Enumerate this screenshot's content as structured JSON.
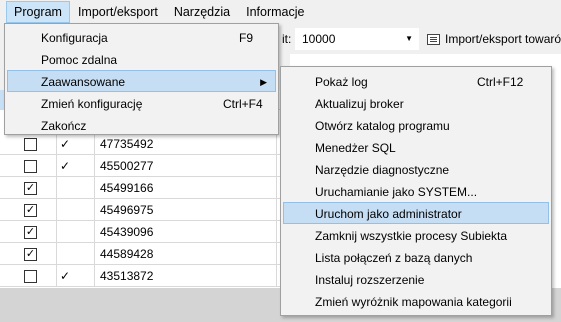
{
  "menubar": {
    "items": [
      {
        "label": "Program"
      },
      {
        "label": "Import/eksport"
      },
      {
        "label": "Narzędzia"
      },
      {
        "label": "Informacje"
      }
    ]
  },
  "toolbar": {
    "limit_label_tail": "it:",
    "limit_value": "10000",
    "import_button_label": "Import/eksport towarów"
  },
  "program_menu": {
    "items": [
      {
        "label": "Konfiguracja",
        "shortcut": "F9"
      },
      {
        "label": "Pomoc zdalna",
        "shortcut": ""
      },
      {
        "label": "Zaawansowane",
        "shortcut": "",
        "submenu": true
      },
      {
        "label": "Zmień konfigurację",
        "shortcut": "Ctrl+F4"
      },
      {
        "label": "Zakończ",
        "shortcut": ""
      }
    ]
  },
  "advanced_submenu": {
    "items": [
      {
        "label": "Pokaż log",
        "shortcut": "Ctrl+F12"
      },
      {
        "label": "Aktualizuj broker",
        "shortcut": ""
      },
      {
        "label": "Otwórz katalog programu",
        "shortcut": ""
      },
      {
        "label": "Menedżer SQL",
        "shortcut": ""
      },
      {
        "label": "Narzędzie diagnostyczne",
        "shortcut": ""
      },
      {
        "label": "Uruchamianie jako SYSTEM...",
        "shortcut": ""
      },
      {
        "label": "Uruchom jako administrator",
        "shortcut": ""
      },
      {
        "label": "Zamknij wszystkie procesy Subiekta",
        "shortcut": ""
      },
      {
        "label": "Lista połączeń z bazą danych",
        "shortcut": ""
      },
      {
        "label": "Instaluj rozszerzenie",
        "shortcut": ""
      },
      {
        "label": "Zmień wyróżnik mapowania kategorii",
        "shortcut": ""
      }
    ]
  },
  "grid": {
    "rows": [
      {
        "checked": false,
        "mark": "✓",
        "number": "47735492"
      },
      {
        "checked": false,
        "mark": "✓",
        "number": "45500277"
      },
      {
        "checked": true,
        "mark": "",
        "number": "45499166"
      },
      {
        "checked": true,
        "mark": "",
        "number": "45496975"
      },
      {
        "checked": true,
        "mark": "",
        "number": "45439096"
      },
      {
        "checked": true,
        "mark": "",
        "number": "44589428"
      },
      {
        "checked": false,
        "mark": "✓",
        "number": "43513872"
      }
    ]
  },
  "glyphs": {
    "check": "✓",
    "checkbox_tick": "☑",
    "dropdown_arrow": "▼",
    "submenu_arrow": "▶"
  }
}
